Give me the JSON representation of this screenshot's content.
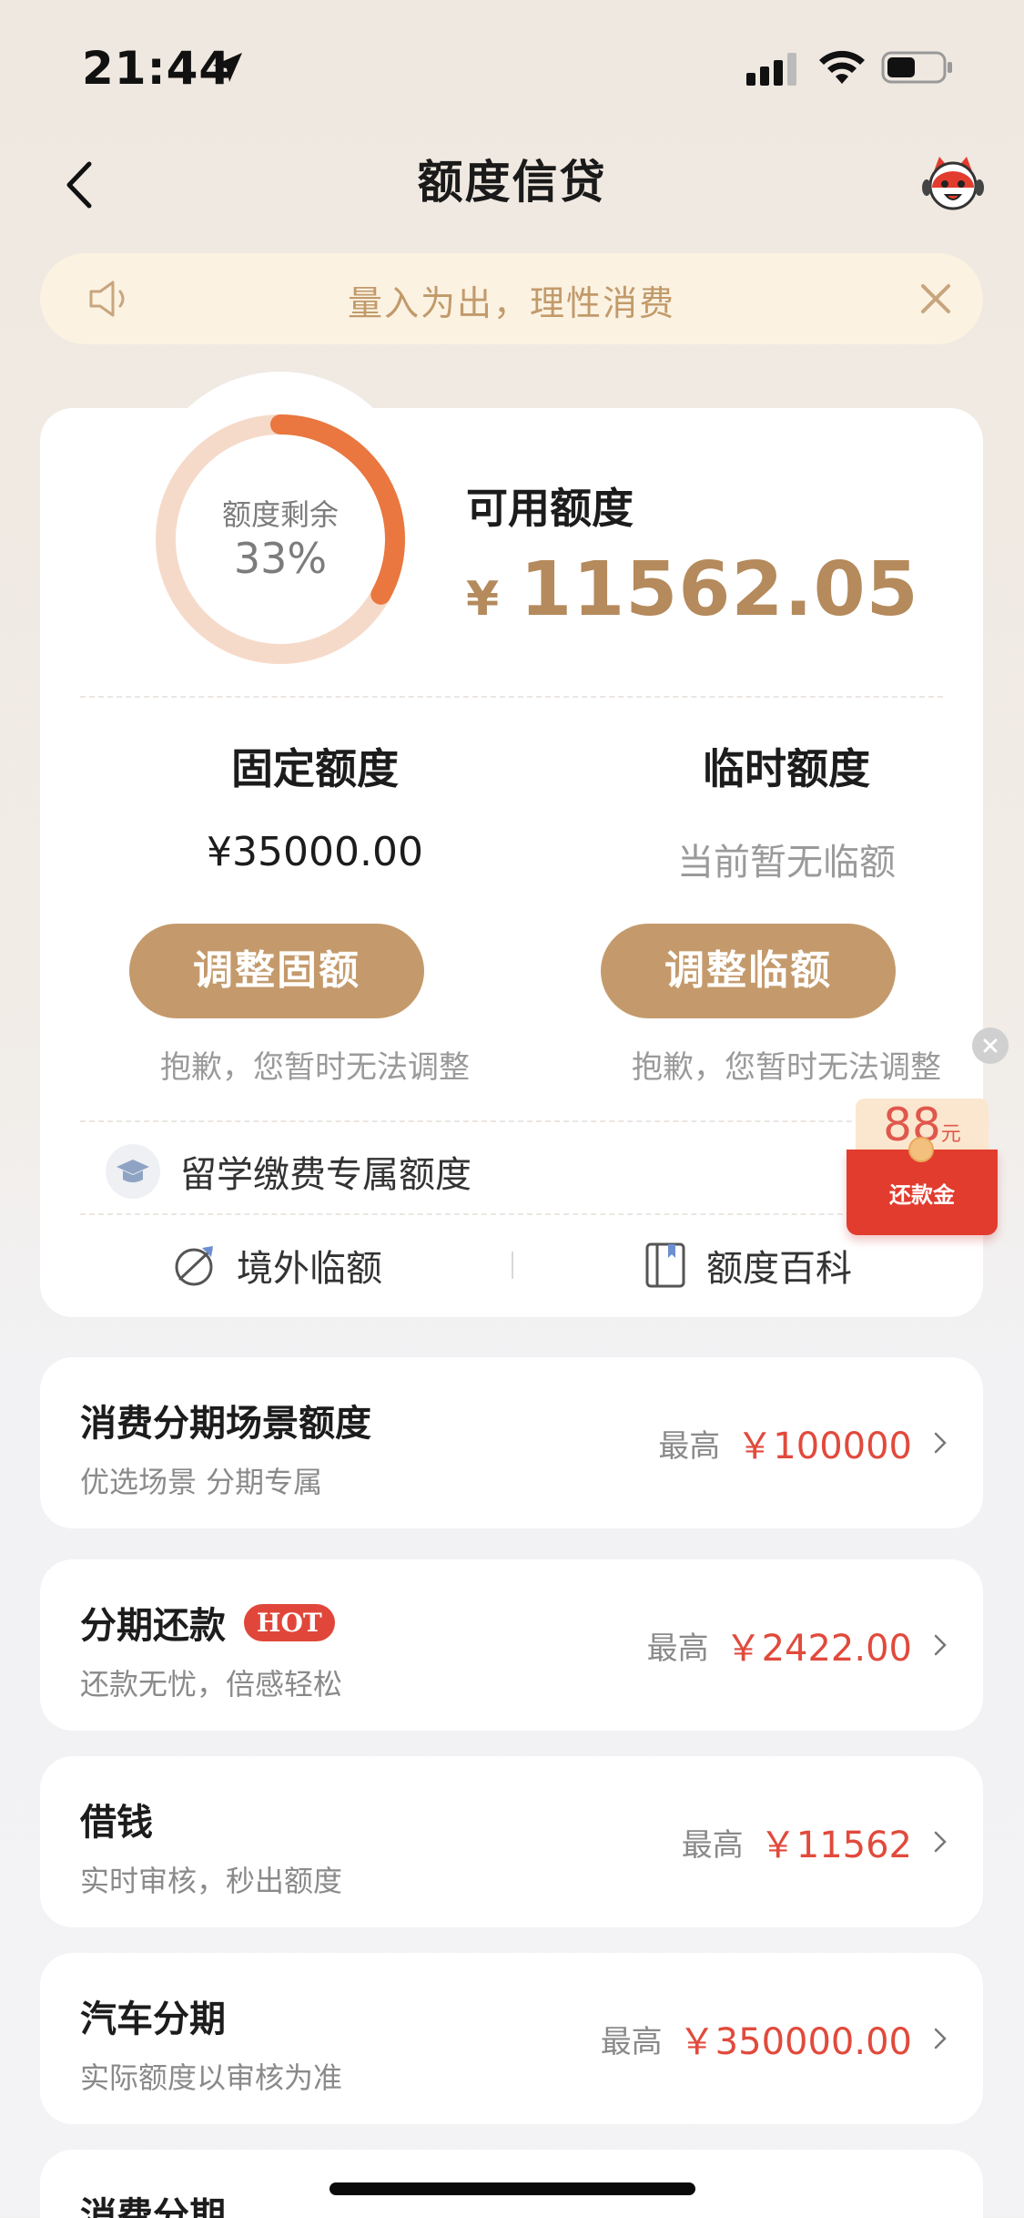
{
  "status_bar": {
    "time": "21:44"
  },
  "nav": {
    "title": "额度信贷"
  },
  "notice": {
    "text": "量入为出，理性消费"
  },
  "credit": {
    "donut_label": "额度剩余",
    "donut_percent_text": "33%",
    "remaining_fraction": 0.33,
    "available_label": "可用额度",
    "available_currency": "¥",
    "available_amount": "11562.05",
    "fixed": {
      "title": "固定额度",
      "value": "¥35000.00",
      "button": "调整固额",
      "note": "抱歉，您暂时无法调整"
    },
    "temporary": {
      "title": "临时额度",
      "value": "当前暂无临额",
      "button": "调整临额",
      "note": "抱歉，您暂时无法调整"
    },
    "study_label": "留学缴费专属额度",
    "links": [
      {
        "label": "境外临额"
      },
      {
        "label": "额度百科"
      }
    ]
  },
  "promo": {
    "amount": "88",
    "unit": "元",
    "label": "还款金"
  },
  "list": [
    {
      "title": "消费分期场景额度",
      "sub": "优选场景 分期专属",
      "max_label": "最高",
      "amount": "￥100000",
      "badge": ""
    },
    {
      "title": "分期还款",
      "sub": "还款无忧，倍感轻松",
      "max_label": "最高",
      "amount": "￥2422.00",
      "badge": "HOT"
    },
    {
      "title": "借钱",
      "sub": "实时审核，秒出额度",
      "max_label": "最高",
      "amount": "￥11562",
      "badge": ""
    },
    {
      "title": "汽车分期",
      "sub": "实际额度以审核为准",
      "max_label": "最高",
      "amount": "￥350000.00",
      "badge": ""
    },
    {
      "title": "消费分期"
    }
  ],
  "colors": {
    "accent_gold": "#c49a6c",
    "amount_gold": "#b58a5c",
    "donut_orange": "#e9773f",
    "donut_track": "#f6dac9",
    "price_red": "#e14a3c"
  }
}
